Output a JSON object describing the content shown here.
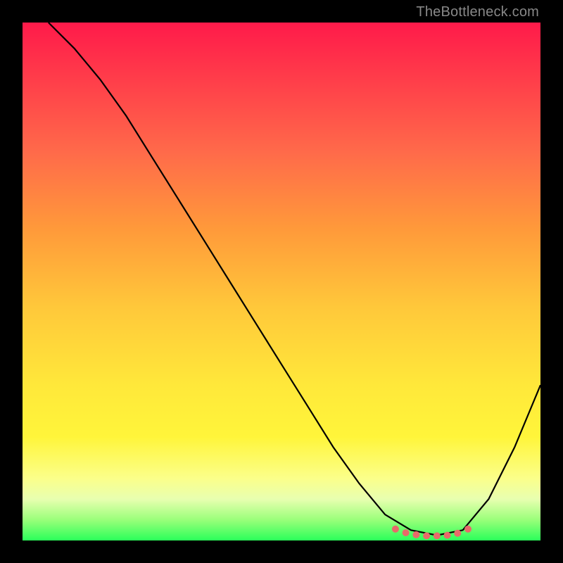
{
  "watermark": "TheBottleneck.com",
  "chart_data": {
    "type": "line",
    "title": "",
    "xlabel": "",
    "ylabel": "",
    "xlim": [
      0,
      100
    ],
    "ylim": [
      0,
      100
    ],
    "grid": false,
    "legend": false,
    "series": [
      {
        "name": "curve",
        "x": [
          5,
          10,
          15,
          20,
          25,
          30,
          35,
          40,
          45,
          50,
          55,
          60,
          65,
          70,
          75,
          80,
          85,
          90,
          95,
          100
        ],
        "y": [
          100,
          95,
          89,
          82,
          74,
          66,
          58,
          50,
          42,
          34,
          26,
          18,
          11,
          5,
          2,
          1,
          2,
          8,
          18,
          30
        ]
      }
    ],
    "highlight_dots": {
      "name": "near-minimum",
      "x": [
        72,
        74,
        76,
        78,
        80,
        82,
        84,
        86
      ],
      "y": [
        2.2,
        1.5,
        1.1,
        0.9,
        0.9,
        1.0,
        1.4,
        2.2
      ]
    }
  },
  "colors": {
    "curve": "#000000",
    "dots": "#e86a6a"
  }
}
